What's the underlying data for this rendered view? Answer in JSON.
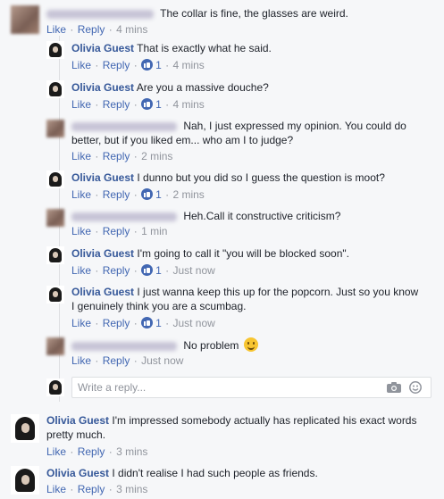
{
  "comments": [
    {
      "name": "",
      "text": "The collar is fine, the glasses are weird.",
      "like": "Like",
      "reply": "Reply",
      "time": "4 mins",
      "likes": ""
    },
    {
      "name": "Olivia Guest",
      "text": "That is exactly what he said.",
      "like": "Like",
      "reply": "Reply",
      "time": "4 mins",
      "likes": "1"
    },
    {
      "name": "Olivia Guest",
      "text": "Are you a massive douche?",
      "like": "Like",
      "reply": "Reply",
      "time": "4 mins",
      "likes": "1"
    },
    {
      "name": "",
      "text": "Nah, I just expressed my opinion. You could do",
      "text2": "better, but if you liked em... who am I to judge?",
      "like": "Like",
      "reply": "Reply",
      "time": "2 mins",
      "likes": ""
    },
    {
      "name": "Olivia Guest",
      "text": "I dunno but you did so I guess the question is moot?",
      "like": "Like",
      "reply": "Reply",
      "time": "2 mins",
      "likes": "1"
    },
    {
      "name": "",
      "text": "Heh.Call it constructive criticism?",
      "like": "Like",
      "reply": "Reply",
      "time": "1 min",
      "likes": ""
    },
    {
      "name": "Olivia Guest",
      "text": "I'm going to call it \"you will be blocked soon\".",
      "like": "Like",
      "reply": "Reply",
      "time": "Just now",
      "likes": "1"
    },
    {
      "name": "Olivia Guest",
      "text": "I just wanna keep this up for the popcorn. Just so you know",
      "text2": "I genuinely think you are a scumbag.",
      "like": "Like",
      "reply": "Reply",
      "time": "Just now",
      "likes": "1"
    },
    {
      "name": "",
      "text": "No problem",
      "like": "Like",
      "reply": "Reply",
      "time": "Just now",
      "likes": "",
      "emoji": "smile-emoji"
    },
    {
      "name": "Olivia Guest",
      "text": "I'm impressed somebody actually has replicated his exact words",
      "text2": "pretty much.",
      "like": "Like",
      "reply": "Reply",
      "time": "3 mins",
      "likes": ""
    },
    {
      "name": "Olivia Guest",
      "text": "I didn't realise I had such people as friends.",
      "like": "Like",
      "reply": "Reply",
      "time": "3 mins",
      "likes": ""
    }
  ],
  "reply_box": {
    "placeholder": "Write a reply...",
    "icons": [
      "camera-icon",
      "sticker-icon"
    ]
  },
  "colors": {
    "link": "#4267b2",
    "name": "#365899",
    "muted": "#90949c",
    "background": "#f6f7f9"
  }
}
